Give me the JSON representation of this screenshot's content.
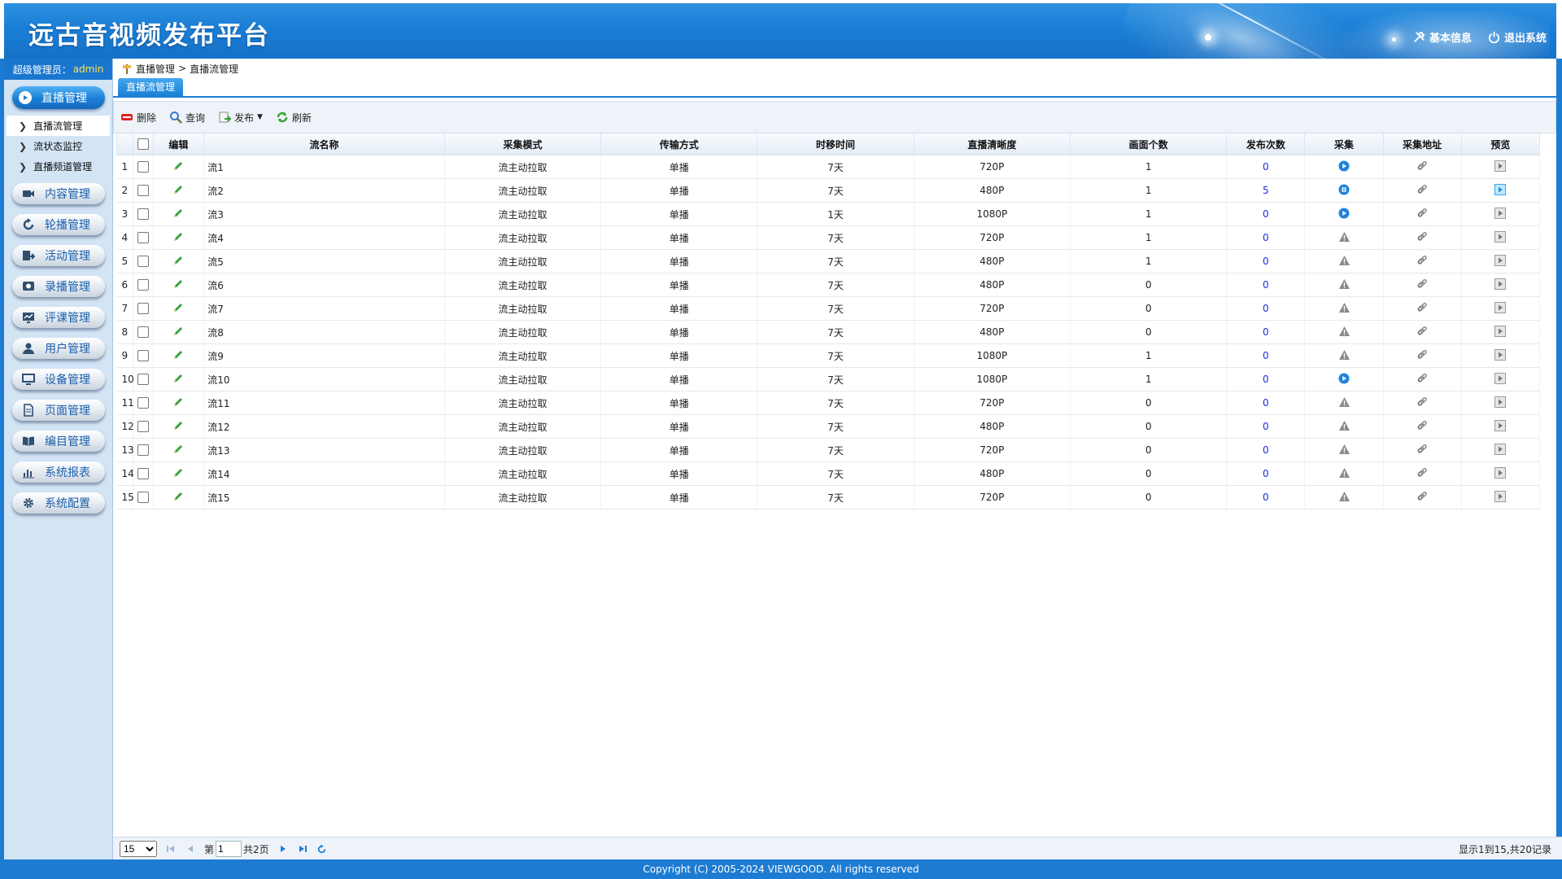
{
  "header": {
    "title": "远古音视频发布平台",
    "links": [
      {
        "label": "基本信息",
        "icon": "tools-icon"
      },
      {
        "label": "退出系统",
        "icon": "power-icon"
      }
    ]
  },
  "sidebar": {
    "admin_prefix": "超级管理员：",
    "admin_name": "admin",
    "active_menu": {
      "label": "直播管理",
      "icon": "play-circle-icon"
    },
    "sub_items": [
      {
        "label": "直播流管理",
        "active": true
      },
      {
        "label": "流状态监控",
        "active": false
      },
      {
        "label": "直播频道管理",
        "active": false
      }
    ],
    "menus": [
      {
        "label": "内容管理",
        "icon": "video-camera-icon"
      },
      {
        "label": "轮播管理",
        "icon": "rotate-icon"
      },
      {
        "label": "活动管理",
        "icon": "activity-icon"
      },
      {
        "label": "录播管理",
        "icon": "record-icon"
      },
      {
        "label": "评课管理",
        "icon": "monitor-chart-icon"
      },
      {
        "label": "用户管理",
        "icon": "user-icon"
      },
      {
        "label": "设备管理",
        "icon": "computer-icon"
      },
      {
        "label": "页面管理",
        "icon": "page-icon"
      },
      {
        "label": "编目管理",
        "icon": "book-icon"
      },
      {
        "label": "系统报表",
        "icon": "bar-chart-icon"
      },
      {
        "label": "系统配置",
        "icon": "gear-icon"
      }
    ]
  },
  "breadcrumb": {
    "part1": "直播管理",
    "sep": ">",
    "part2": "直播流管理"
  },
  "tab": {
    "label": "直播流管理"
  },
  "toolbar": {
    "delete": "删除",
    "query": "查询",
    "publish": "发布",
    "refresh": "刷新"
  },
  "table": {
    "columns": [
      "",
      "编辑",
      "流名称",
      "采集模式",
      "传输方式",
      "时移时间",
      "直播清晰度",
      "画面个数",
      "发布次数",
      "采集",
      "采集地址",
      "预览"
    ],
    "rows": [
      {
        "n": "1",
        "name": "流1",
        "mode": "流主动拉取",
        "trans": "单播",
        "shift": "7天",
        "res": "720P",
        "screens": "1",
        "pub": "0",
        "collect": "play"
      },
      {
        "n": "2",
        "name": "流2",
        "mode": "流主动拉取",
        "trans": "单播",
        "shift": "7天",
        "res": "480P",
        "screens": "1",
        "pub": "5",
        "collect": "pause"
      },
      {
        "n": "3",
        "name": "流3",
        "mode": "流主动拉取",
        "trans": "单播",
        "shift": "1天",
        "res": "1080P",
        "screens": "1",
        "pub": "0",
        "collect": "play"
      },
      {
        "n": "4",
        "name": "流4",
        "mode": "流主动拉取",
        "trans": "单播",
        "shift": "7天",
        "res": "720P",
        "screens": "1",
        "pub": "0",
        "collect": "warn"
      },
      {
        "n": "5",
        "name": "流5",
        "mode": "流主动拉取",
        "trans": "单播",
        "shift": "7天",
        "res": "480P",
        "screens": "1",
        "pub": "0",
        "collect": "warn"
      },
      {
        "n": "6",
        "name": "流6",
        "mode": "流主动拉取",
        "trans": "单播",
        "shift": "7天",
        "res": "480P",
        "screens": "0",
        "pub": "0",
        "collect": "warn"
      },
      {
        "n": "7",
        "name": "流7",
        "mode": "流主动拉取",
        "trans": "单播",
        "shift": "7天",
        "res": "720P",
        "screens": "0",
        "pub": "0",
        "collect": "warn"
      },
      {
        "n": "8",
        "name": "流8",
        "mode": "流主动拉取",
        "trans": "单播",
        "shift": "7天",
        "res": "480P",
        "screens": "0",
        "pub": "0",
        "collect": "warn"
      },
      {
        "n": "9",
        "name": "流9",
        "mode": "流主动拉取",
        "trans": "单播",
        "shift": "7天",
        "res": "1080P",
        "screens": "1",
        "pub": "0",
        "collect": "warn"
      },
      {
        "n": "10",
        "name": "流10",
        "mode": "流主动拉取",
        "trans": "单播",
        "shift": "7天",
        "res": "1080P",
        "screens": "1",
        "pub": "0",
        "collect": "play"
      },
      {
        "n": "11",
        "name": "流11",
        "mode": "流主动拉取",
        "trans": "单播",
        "shift": "7天",
        "res": "720P",
        "screens": "0",
        "pub": "0",
        "collect": "warn"
      },
      {
        "n": "12",
        "name": "流12",
        "mode": "流主动拉取",
        "trans": "单播",
        "shift": "7天",
        "res": "480P",
        "screens": "0",
        "pub": "0",
        "collect": "warn"
      },
      {
        "n": "13",
        "name": "流13",
        "mode": "流主动拉取",
        "trans": "单播",
        "shift": "7天",
        "res": "720P",
        "screens": "0",
        "pub": "0",
        "collect": "warn"
      },
      {
        "n": "14",
        "name": "流14",
        "mode": "流主动拉取",
        "trans": "单播",
        "shift": "7天",
        "res": "480P",
        "screens": "0",
        "pub": "0",
        "collect": "warn"
      },
      {
        "n": "15",
        "name": "流15",
        "mode": "流主动拉取",
        "trans": "单播",
        "shift": "7天",
        "res": "720P",
        "screens": "0",
        "pub": "0",
        "collect": "warn"
      }
    ]
  },
  "pager": {
    "page_size": "15",
    "page_prefix": "第",
    "page_value": "1",
    "page_suffix": "共2页",
    "info": "显示1到15,共20记录"
  },
  "footer": {
    "copyright": "Copyright (C) 2005-2024 VIEWGOOD. All rights reserved"
  },
  "colors": {
    "brand_blue": "#1a7fd6",
    "link_blue": "#1d2fd3",
    "admin_name": "#ffe14d"
  }
}
